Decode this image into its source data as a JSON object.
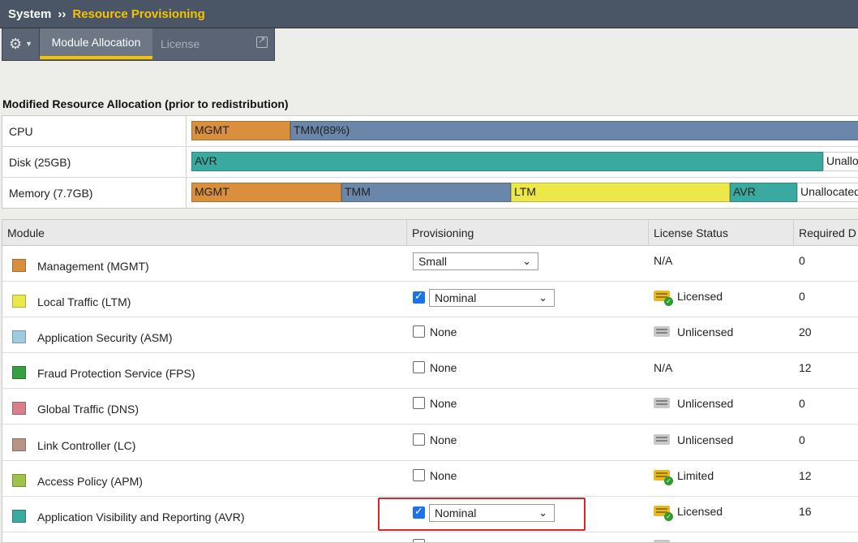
{
  "breadcrumb": {
    "root": "System",
    "separator": "››",
    "current": "Resource Provisioning"
  },
  "tabs": {
    "active": "Module Allocation",
    "other": "License"
  },
  "section_title": "Modified Resource Allocation (prior to redistribution)",
  "allocation": [
    {
      "label": "CPU",
      "segments": [
        {
          "text": "MGMT",
          "color": "#d98f3c"
        },
        {
          "text": "TMM(89%)",
          "color": "#6a86a8"
        }
      ]
    },
    {
      "label": "Disk (25GB)",
      "segments": [
        {
          "text": "AVR",
          "color": "#3aa9a0"
        },
        {
          "text": "Unallocated",
          "color": "#ffffff"
        }
      ]
    },
    {
      "label": "Memory (7.7GB)",
      "segments": [
        {
          "text": "MGMT",
          "color": "#d98f3c"
        },
        {
          "text": "TMM",
          "color": "#6a86a8"
        },
        {
          "text": "LTM",
          "color": "#ece84a"
        },
        {
          "text": "AVR",
          "color": "#3aa9a0"
        },
        {
          "text": "Unallocated",
          "color": "#ffffff"
        }
      ]
    }
  ],
  "table": {
    "headers": [
      "Module",
      "Provisioning",
      "License Status",
      "Required D"
    ],
    "rows": [
      {
        "module": "Management (MGMT)",
        "color": "#d98f3c",
        "checkbox": null,
        "provisioning": "Small",
        "license": "N/A",
        "license_icon": null,
        "required": "0"
      },
      {
        "module": "Local Traffic (LTM)",
        "color": "#ece84a",
        "checkbox": true,
        "provisioning": "Nominal",
        "license": "Licensed",
        "license_icon": "licensed",
        "required": "0"
      },
      {
        "module": "Application Security (ASM)",
        "color": "#9fcbe0",
        "checkbox": false,
        "provisioning": "None",
        "license": "Unlicensed",
        "license_icon": "unlicensed",
        "required": "20"
      },
      {
        "module": "Fraud Protection Service (FPS)",
        "color": "#34a03f",
        "checkbox": false,
        "provisioning": "None",
        "license": "N/A",
        "license_icon": null,
        "required": "12"
      },
      {
        "module": "Global Traffic (DNS)",
        "color": "#d97f8a",
        "checkbox": false,
        "provisioning": "None",
        "license": "Unlicensed",
        "license_icon": "unlicensed",
        "required": "0"
      },
      {
        "module": "Link Controller (LC)",
        "color": "#b99485",
        "checkbox": false,
        "provisioning": "None",
        "license": "Unlicensed",
        "license_icon": "unlicensed",
        "required": "0"
      },
      {
        "module": "Access Policy (APM)",
        "color": "#9fc14a",
        "checkbox": false,
        "provisioning": "None",
        "license": "Limited",
        "license_icon": "licensed",
        "required": "12"
      },
      {
        "module": "Application Visibility and Reporting (AVR)",
        "color": "#3aa9a0",
        "checkbox": true,
        "provisioning": "Nominal",
        "license": "Licensed",
        "license_icon": "licensed",
        "required": "16"
      }
    ]
  },
  "colors": {
    "accent": "#f5c400",
    "highlight": "#d9262b",
    "header_bar": "#4a5565"
  }
}
